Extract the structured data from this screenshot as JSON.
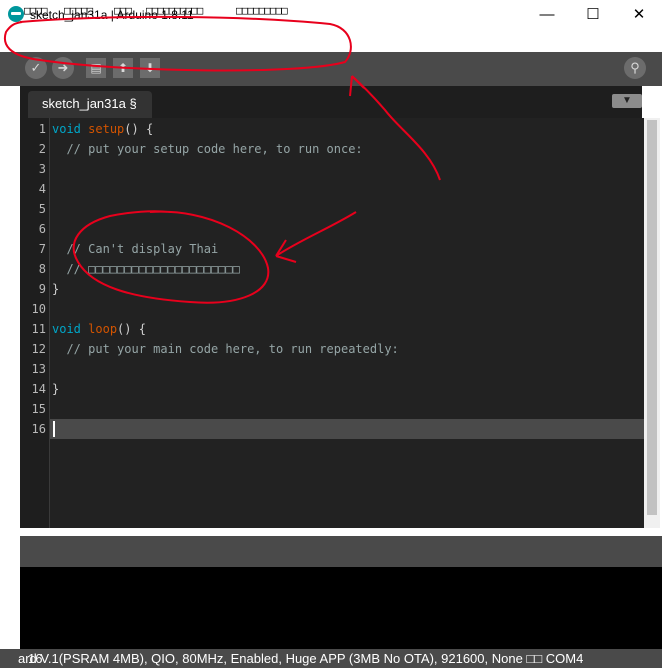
{
  "window": {
    "title": "sketch_jan31a | Arduino 1.8.11",
    "minimize_glyph": "—",
    "maximize_glyph": "☐",
    "close_glyph": "✕"
  },
  "menu": {
    "items": [
      "□□□□",
      "□□□□□",
      "□□□",
      "□□□□□□□□□□",
      "□□□□□□□□□"
    ]
  },
  "toolbar": {
    "verify_icon": "check-icon",
    "upload_icon": "arrow-right-icon",
    "new_icon": "document-icon",
    "open_icon": "arrow-up-icon",
    "save_icon": "arrow-down-icon",
    "serial_monitor_icon": "magnifier-icon"
  },
  "tab": {
    "label": "sketch_jan31a §"
  },
  "editor": {
    "line_numbers": [
      "1",
      "2",
      "3",
      "4",
      "5",
      "6",
      "7",
      "8",
      "9",
      "10",
      "11",
      "12",
      "13",
      "14",
      "15",
      "16"
    ],
    "lines": [
      {
        "kw": "void",
        "fn": "setup",
        "rest": "() {"
      },
      {
        "comment": "  // put your setup code here, to run once:"
      },
      {
        "text": ""
      },
      {
        "text": ""
      },
      {
        "text": ""
      },
      {
        "text": ""
      },
      {
        "comment": "  // Can't display Thai"
      },
      {
        "comment": "  // □□□□□□□□□□□□□□□□□□□□□"
      },
      {
        "text": "}"
      },
      {
        "text": ""
      },
      {
        "kw": "void",
        "fn": "loop",
        "rest": "() {"
      },
      {
        "comment": "  // put your main code here, to run repeatedly:"
      },
      {
        "text": ""
      },
      {
        "text": "}"
      },
      {
        "text": ""
      },
      {
        "text": ""
      }
    ],
    "current_line": 16
  },
  "status": {
    "text": "ard V.1(PSRAM 4MB), QIO, 80MHz, Enabled, Huge APP (3MB No OTA), 921600, None □□ COM4",
    "prefix_overlap": "16"
  },
  "colors": {
    "keyword": "#00a6c8",
    "function": "#d35400",
    "comment": "#95a5a6",
    "annotation": "#e8001c",
    "accent": "#00979c"
  }
}
